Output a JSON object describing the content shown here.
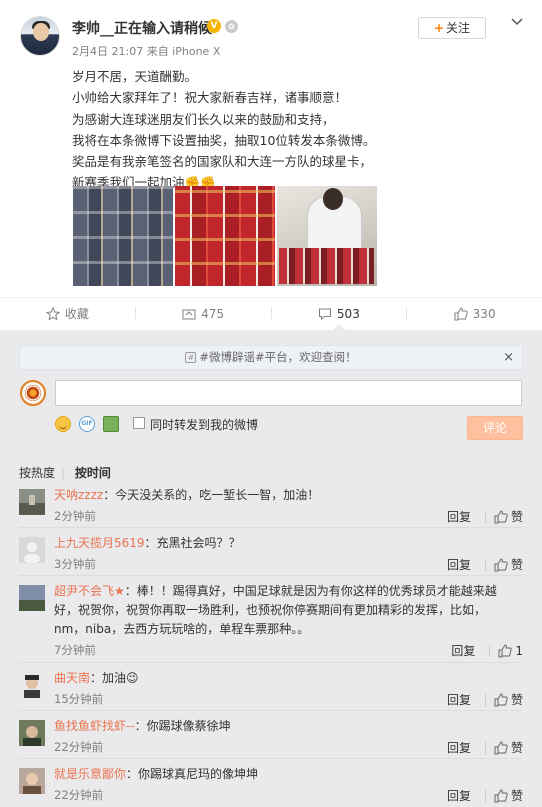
{
  "post": {
    "username": "李帅__正在输入请稍候",
    "follow_label": "关注",
    "meta": "2月4日 21:07 来自 iPhone X",
    "text_lines": [
      "岁月不居，天道酬勤。",
      "小帅给大家拜年了！祝大家新春吉祥，诸事顺意！",
      "为感谢大连球迷朋友们长久以来的鼓励和支持，",
      "我将在本条微博下设置抽奖，抽取10位转发本条微博。",
      "奖品是有我亲笔签名的国家队和大连一方队的球星卡，",
      "新赛季我们一起加油✊✊"
    ],
    "actions": {
      "favorite": "收藏",
      "repost": "475",
      "comment": "503",
      "like": "330"
    }
  },
  "composer": {
    "notice": "#微博辟谣#平台，欢迎查阅！",
    "repost_label": "同时转发到我的微博",
    "comment_btn": "评论"
  },
  "sort": {
    "hot": "按热度",
    "time": "按时间"
  },
  "comments": [
    {
      "name": "天呐zzzz",
      "text": "：今天没关系的，吃一堑长一智，加油！",
      "time": "2分钟前",
      "reply": "回复",
      "like": "赞"
    },
    {
      "name": "上九天揽月5619",
      "text": "：充黑社会吗？？",
      "time": "3分钟前",
      "reply": "回复",
      "like": "赞"
    },
    {
      "name": "超尹不会飞★",
      "text": "：棒！！踢得真好，中国足球就是因为有你这样的优秀球员才能越来越好，祝贺你，祝贺你再取一场胜利，也预祝你停赛期间有更加精彩的发挥，比如，nm，niba，去西方玩玩啥的，单程车票那种。。",
      "time": "7分钟前",
      "reply": "回复",
      "like": "1"
    },
    {
      "name": "曲天南",
      "text": "：加油😉",
      "time": "15分钟前",
      "reply": "回复",
      "like": "赞"
    },
    {
      "name": "鱼找鱼虾找虾--",
      "text": "：你踢球像蔡徐坤",
      "time": "22分钟前",
      "reply": "回复",
      "like": "赞"
    },
    {
      "name": "就是乐意鄙你",
      "text": "：你踢球真尼玛的像坤坤",
      "time": "22分钟前",
      "reply": "回复",
      "like": "赞"
    }
  ]
}
